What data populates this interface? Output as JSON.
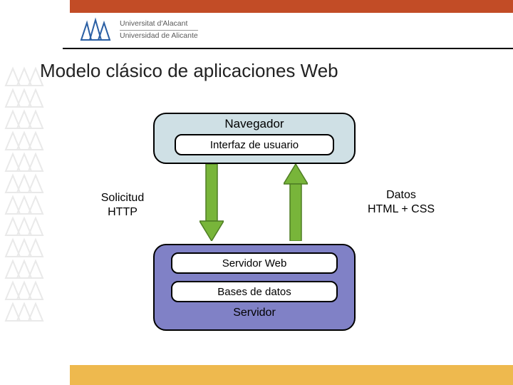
{
  "university": {
    "line1": "Universitat d'Alacant",
    "line2": "Universidad de Alicante"
  },
  "slide": {
    "title": "Modelo clásico de aplicaciones Web"
  },
  "diagram": {
    "browser": {
      "title": "Navegador",
      "ui_label": "Interfaz de usuario"
    },
    "request": {
      "line1": "Solicitud",
      "line2": "HTTP"
    },
    "response": {
      "line1": "Datos",
      "line2": "HTML + CSS"
    },
    "server": {
      "webserver": "Servidor Web",
      "database": "Bases de datos",
      "label": "Servidor"
    }
  },
  "colors": {
    "topbar": "#c24c26",
    "bottombar": "#eeb94e",
    "browser_bg": "#cfe0e5",
    "server_bg": "#8081c6",
    "arrow": "#78b53a"
  }
}
